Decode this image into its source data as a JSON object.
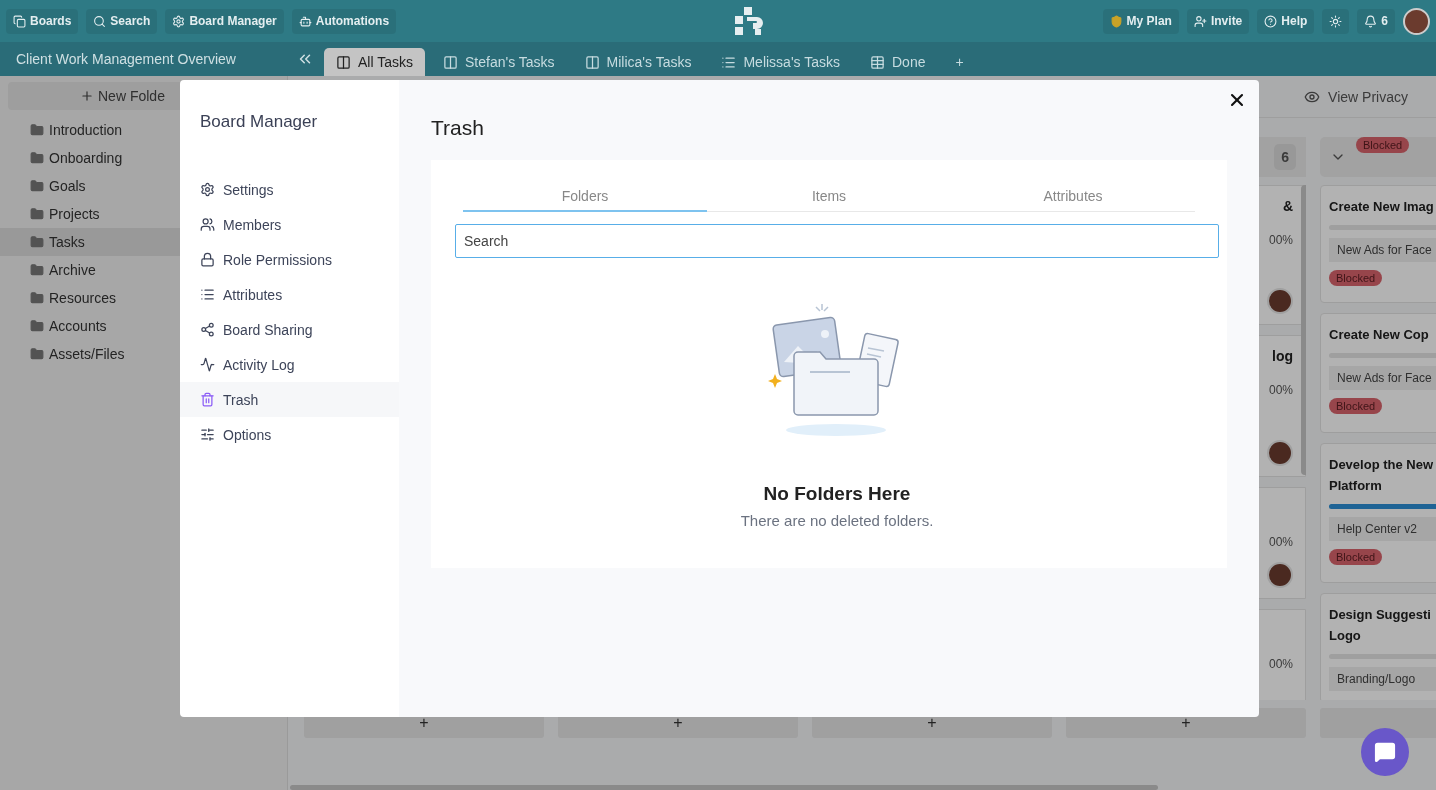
{
  "top_bar": {
    "left_buttons": [
      {
        "kind": "boards",
        "label": "Boards"
      },
      {
        "kind": "search",
        "label": "Search"
      },
      {
        "kind": "manager",
        "label": "Board Manager"
      },
      {
        "kind": "automations",
        "label": "Automations"
      }
    ],
    "right_buttons": [
      {
        "kind": "plan",
        "label": "My Plan"
      },
      {
        "kind": "invite",
        "label": "Invite"
      },
      {
        "kind": "help",
        "label": "Help"
      },
      {
        "kind": "theme"
      },
      {
        "kind": "notifications",
        "label": "6"
      }
    ]
  },
  "board_title": "Client Work Management Overview",
  "tabs": [
    {
      "kind": "board",
      "label": "All Tasks",
      "selected": true
    },
    {
      "kind": "board",
      "label": "Stefan's Tasks",
      "selected": false
    },
    {
      "kind": "board",
      "label": "Milica's Tasks",
      "selected": false
    },
    {
      "kind": "list",
      "label": "Melissa's Tasks",
      "selected": false
    },
    {
      "kind": "table",
      "label": "Done",
      "selected": false
    },
    {
      "kind": "add",
      "label": "+",
      "selected": false
    }
  ],
  "sidebar": {
    "new_folder": "New Folde",
    "folders": [
      {
        "label": "Introduction",
        "selected": false
      },
      {
        "label": "Onboarding",
        "selected": false
      },
      {
        "label": "Goals",
        "selected": false
      },
      {
        "label": "Projects",
        "selected": false
      },
      {
        "label": "Tasks",
        "selected": true
      },
      {
        "label": "Archive",
        "selected": false
      },
      {
        "label": "Resources",
        "selected": false
      },
      {
        "label": "Accounts",
        "selected": false
      },
      {
        "label": "Assets/Files",
        "selected": false
      }
    ]
  },
  "board": {
    "view_privacy": "View Privacy",
    "columns": [
      {
        "kind": "hidden",
        "add_label": "+"
      },
      {
        "kind": "hidden",
        "add_label": "+"
      },
      {
        "kind": "hidden",
        "add_label": "+"
      },
      {
        "kind": "partial",
        "add_label": "+",
        "count": "6",
        "cards": [
          {
            "title": "&",
            "percent": "00%",
            "avatar": true
          },
          {
            "title": "log",
            "percent": "00%",
            "avatar": true
          },
          {
            "percent": "00%",
            "avatar": true
          },
          {
            "percent": "00%",
            "avatar": false
          }
        ]
      },
      {
        "kind": "status",
        "status": "Blocked",
        "cards": [
          {
            "title_lines": [
              "Create New Imag"
            ],
            "level": 0,
            "tag": "New Ads for Face",
            "status": "Blocked"
          },
          {
            "title_lines": [
              "Create New Cop"
            ],
            "level": 0,
            "tag": "New Ads for Face",
            "status": "Blocked"
          },
          {
            "title_lines": [
              "Develop the New",
              "Platform"
            ],
            "level": 1,
            "tag": "Help Center v2",
            "status": "Blocked"
          },
          {
            "title_lines": [
              "Design Suggesti",
              "Logo"
            ],
            "level": 0,
            "tag": "Branding/Logo"
          }
        ]
      }
    ]
  },
  "modal": {
    "title": "Board Manager",
    "nav": [
      {
        "kind": "settings",
        "label": "Settings",
        "selected": false
      },
      {
        "kind": "members",
        "label": "Members",
        "selected": false
      },
      {
        "kind": "lock",
        "label": "Role Permissions",
        "selected": false
      },
      {
        "kind": "list",
        "label": "Attributes",
        "selected": false
      },
      {
        "kind": "share",
        "label": "Board Sharing",
        "selected": false
      },
      {
        "kind": "activity",
        "label": "Activity Log",
        "selected": false
      },
      {
        "kind": "trash",
        "label": "Trash",
        "selected": true
      },
      {
        "kind": "options",
        "label": "Options",
        "selected": false
      }
    ],
    "heading": "Trash",
    "tabs": [
      {
        "label": "Folders",
        "selected": true
      },
      {
        "label": "Items",
        "selected": false
      },
      {
        "label": "Attributes",
        "selected": false
      }
    ],
    "search": {
      "placeholder": "Search"
    },
    "empty_title": "No Folders Here",
    "empty_text": "There are no deleted folders."
  }
}
